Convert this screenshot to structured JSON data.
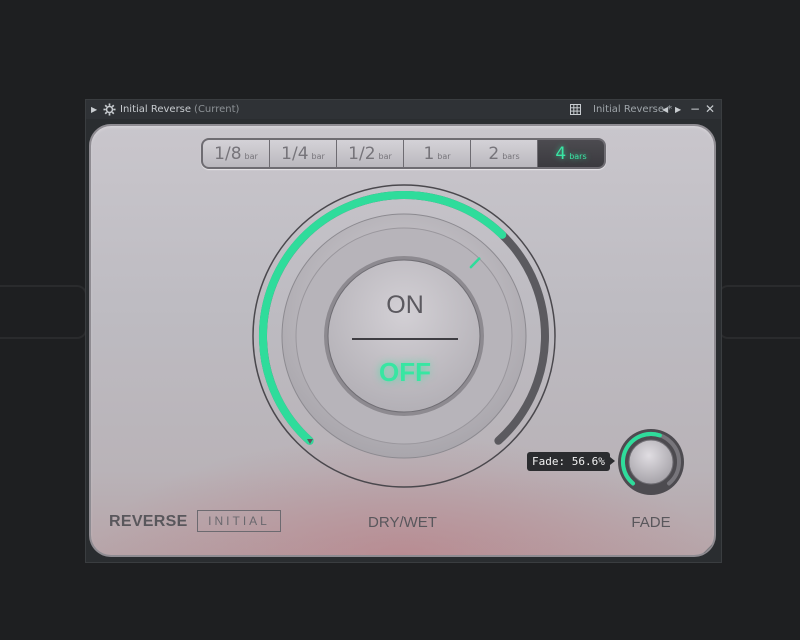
{
  "window": {
    "title": "Initial Reverse",
    "title_suffix": "(Current)",
    "preset_name": "Initial Reverse *",
    "icons": {
      "menu": "triangle-right-icon",
      "plugin": "gear-icon",
      "browser": "grid-icon",
      "prev": "triangle-left-icon",
      "next": "triangle-right-icon",
      "minimize": "minimize-icon",
      "close": "close-icon"
    }
  },
  "lengths": [
    {
      "value": "1/8",
      "unit": "bar",
      "active": false
    },
    {
      "value": "1/4",
      "unit": "bar",
      "active": false
    },
    {
      "value": "1/2",
      "unit": "bar",
      "active": false
    },
    {
      "value": "1",
      "unit": "bar",
      "active": false
    },
    {
      "value": "2",
      "unit": "bars",
      "active": false
    },
    {
      "value": "4",
      "unit": "bars",
      "active": true
    }
  ],
  "switch": {
    "on_label": "ON",
    "off_label": "OFF",
    "state": "OFF"
  },
  "drywet": {
    "label": "DRY/WET",
    "value": 0.66
  },
  "fade": {
    "label": "FADE",
    "tooltip": "Fade: 56.6%",
    "value": 0.566
  },
  "branding": {
    "name": "REVERSE",
    "maker": "INITIAL"
  },
  "colors": {
    "accent": "#39e6a4",
    "panel": "#c5c2c8",
    "text": "#59575c",
    "window_bg": "#2a2d30"
  }
}
